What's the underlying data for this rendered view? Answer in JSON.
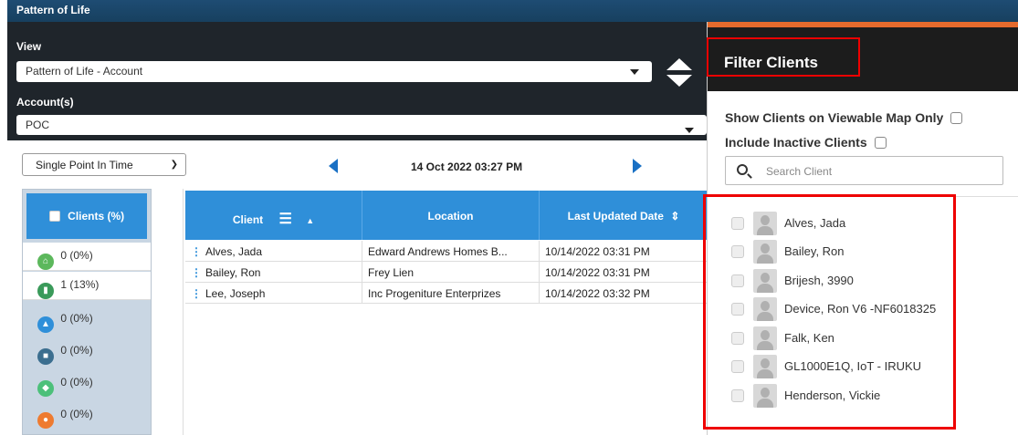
{
  "window": {
    "title": "Pattern of Life"
  },
  "header": {
    "view_label": "View",
    "view_value": "Pattern of Life - Account",
    "accounts_label": "Account(s)",
    "accounts_value": "POC"
  },
  "time": {
    "mode": "Single Point In Time",
    "date": "14 Oct 2022 03:27 PM"
  },
  "categories": {
    "header": "Clients (%)",
    "items": [
      {
        "label": "0 (0%)",
        "icon": "home-icon",
        "color": "#5cb85c"
      },
      {
        "label": "1 (13%)",
        "icon": "building-icon",
        "color": "#3a9a5a"
      },
      {
        "label": "0 (0%)",
        "icon": "graduation-cap-icon",
        "color": "#2f8fd9"
      },
      {
        "label": "0 (0%)",
        "icon": "shopping-bag-icon",
        "color": "#3b6e8f"
      },
      {
        "label": "0 (0%)",
        "icon": "tag-icon",
        "color": "#4cc07a"
      },
      {
        "label": "0 (0%)",
        "icon": "pill-icon",
        "color": "#ee7b30"
      }
    ]
  },
  "table": {
    "columns": [
      "Client",
      "Location",
      "Last Updated Date"
    ],
    "rows": [
      {
        "client": "Alves, Jada",
        "location": "Edward Andrews Homes B...",
        "updated": "10/14/2022 03:31 PM"
      },
      {
        "client": "Bailey, Ron",
        "location": "Frey Lien",
        "updated": "10/14/2022 03:31 PM"
      },
      {
        "client": "Lee, Joseph",
        "location": "Inc Progeniture Enterprizes",
        "updated": "10/14/2022 03:32 PM"
      }
    ]
  },
  "filter": {
    "title": "Filter Clients",
    "show_viewable": "Show Clients on Viewable Map Only",
    "include_inactive": "Include Inactive Clients",
    "search_placeholder": "Search Client",
    "clients": [
      "Alves, Jada",
      "Bailey, Ron",
      "Brijesh, 3990",
      "Device, Ron V6 -NF6018325",
      "Falk, Ken",
      "GL1000E1Q, IoT - IRUKU",
      "Henderson, Vickie"
    ]
  },
  "colors": {
    "accent": "#2f8fd9",
    "highlight": "#e00000",
    "header_bg": "#1f252b",
    "orange": "#e56b2d"
  }
}
